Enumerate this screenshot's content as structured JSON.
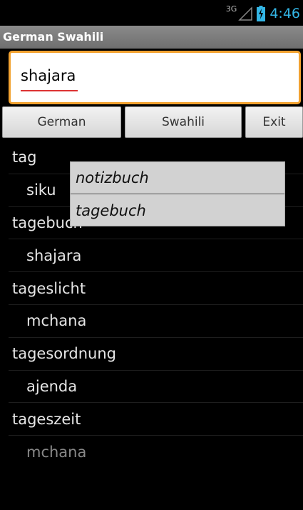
{
  "status": {
    "network": "3G",
    "time": "4:46"
  },
  "app": {
    "title": "German Swahili"
  },
  "search": {
    "value": "shajara"
  },
  "buttons": {
    "german": "German",
    "swahili": "Swahili",
    "exit": "Exit"
  },
  "results": [
    {
      "term": "tag",
      "translation": "siku"
    },
    {
      "term": "tagebuch",
      "translation": "shajara"
    },
    {
      "term": "tageslicht",
      "translation": "mchana"
    },
    {
      "term": "tagesordnung",
      "translation": "ajenda"
    },
    {
      "term": "tageszeit",
      "translation": "mchana"
    }
  ],
  "autocomplete": [
    "notizbuch",
    "tagebuch"
  ],
  "colors": {
    "accent": "#33b5e5",
    "focus_border": "#f2a230"
  }
}
